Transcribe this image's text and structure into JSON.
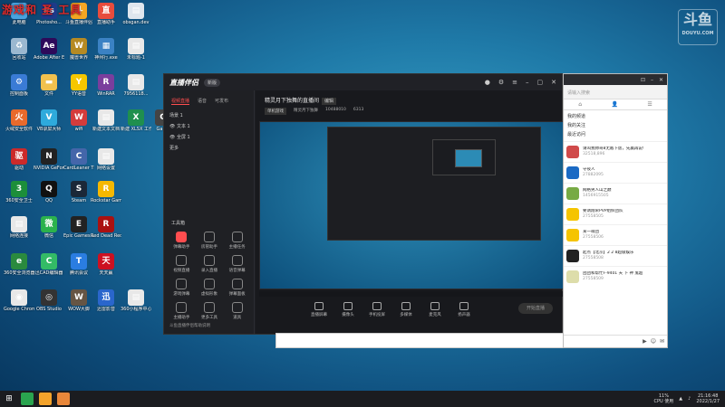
{
  "overlay": {
    "title": "游戏和 圣 工具"
  },
  "watermark": {
    "big": "斗鱼",
    "small": "DOUYU.COM"
  },
  "desktop_icons": [
    {
      "label": "此电脑",
      "color": "#4aa3df",
      "glyph": "▭"
    },
    {
      "label": "Photosho...",
      "color": "#1e3a8a",
      "glyph": "Ps"
    },
    {
      "label": "斗鱼直播伴侣",
      "color": "#f5a623",
      "glyph": "斗"
    },
    {
      "label": "直播助手",
      "color": "#e84c3d",
      "glyph": "直"
    },
    {
      "label": "obsgan.dev",
      "color": "#dfe6ee",
      "glyph": "▤"
    },
    {
      "label": "回收站",
      "color": "#9bb8d0",
      "glyph": "♻"
    },
    {
      "label": "Adobe After Effects 2020",
      "color": "#2d0a5a",
      "glyph": "Ae"
    },
    {
      "label": "魔兽世界",
      "color": "#b58a23",
      "glyph": "W"
    },
    {
      "label": "神州行.exe",
      "color": "#3b82c4",
      "glyph": "▦"
    },
    {
      "label": "未标题-1",
      "color": "#e8e8e8",
      "glyph": "▤"
    },
    {
      "label": "控制面板",
      "color": "#3a7bd5",
      "glyph": "⚙"
    },
    {
      "label": "文件",
      "color": "#f2c14e",
      "glyph": "▬"
    },
    {
      "label": "YY语音",
      "color": "#f6c700",
      "glyph": "Y"
    },
    {
      "label": "WinRAR",
      "color": "#7a3e9d",
      "glyph": "R"
    },
    {
      "label": "7956118...",
      "color": "#e8e8e8",
      "glyph": "▤"
    },
    {
      "label": "火绒安全软件",
      "color": "#e86a2c",
      "glyph": "火"
    },
    {
      "label": "VB录屏大师",
      "color": "#2eaadc",
      "glyph": "V"
    },
    {
      "label": "wifi",
      "color": "#d43c3c",
      "glyph": "W"
    },
    {
      "label": "新建文本文档",
      "color": "#e8e8e8",
      "glyph": "▤"
    },
    {
      "label": "新建 XLSX 工作表",
      "color": "#1f8f4e",
      "glyph": "X"
    },
    {
      "label": "Game",
      "color": "#444",
      "glyph": "G"
    },
    {
      "label": "驱动",
      "color": "#cc2a2a",
      "glyph": "驱"
    },
    {
      "label": "NVIDIA GeForce Experience",
      "color": "#222",
      "glyph": "N"
    },
    {
      "label": "CardLeaner The Coin...",
      "color": "#4466aa",
      "glyph": "C"
    },
    {
      "label": "网络设置",
      "color": "#e8e8e8",
      "glyph": "▤"
    },
    {
      "label": "360安全卫士",
      "color": "#1c8e3a",
      "glyph": "3"
    },
    {
      "label": "QQ",
      "color": "#111",
      "glyph": "Q"
    },
    {
      "label": "Steam",
      "color": "#1b2838",
      "glyph": "S"
    },
    {
      "label": "Rockstar Games Launcher",
      "color": "#f5b800",
      "glyph": "R"
    },
    {
      "label": "网络连接",
      "color": "#e8e8e8",
      "glyph": "▤"
    },
    {
      "label": "微信",
      "color": "#2bb24c",
      "glyph": "微"
    },
    {
      "label": "Epic Games Launcher",
      "color": "#222",
      "glyph": "E"
    },
    {
      "label": "Red Dead Redemption 2",
      "color": "#a11",
      "glyph": "R"
    },
    {
      "label": "360安全浏览器",
      "color": "#2a8a3e",
      "glyph": "e"
    },
    {
      "label": "迅CAD编辑器",
      "color": "#3b6",
      "glyph": "C"
    },
    {
      "label": "腾讯会议",
      "color": "#2a7de1",
      "glyph": "T"
    },
    {
      "label": "天天赢",
      "color": "#c12",
      "glyph": "天"
    },
    {
      "label": "Google Chrome",
      "color": "#e8e8e8",
      "glyph": "◉"
    },
    {
      "label": "OBS Studio",
      "color": "#333",
      "glyph": "◎"
    },
    {
      "label": "WOW大脚",
      "color": "#654",
      "glyph": "W"
    },
    {
      "label": "迅雷影音",
      "color": "#2a66cc",
      "glyph": "迅"
    },
    {
      "label": "360小程序中心",
      "color": "#e8e8e8",
      "glyph": "▤"
    }
  ],
  "app": {
    "logo": "直播伴侣",
    "version": "新版",
    "side_tabs": [
      "视频直播",
      "语音",
      "可发布"
    ],
    "scenes": [
      "场景 1",
      "文本 1",
      "全屏 1",
      "更多"
    ],
    "tools_title": "工具箱",
    "tools": [
      "弹幕助手",
      "房管助手",
      "主播任务",
      "视频直播",
      "录入直播",
      "语音弹幕",
      "游戏弹幕",
      "虚拟形象",
      "弹幕面板",
      "主播助手",
      "更多工具",
      "道具"
    ],
    "side_footer": "斗鱼直播伴侣帮助说明",
    "stream_title": "精灵月下独舞的直播间",
    "edit": "编辑",
    "category": "单机游戏",
    "meta_text": "精灵月下独舞",
    "room_id": "10488010",
    "hot": "6313",
    "bottom_tools": [
      "直播屏幕",
      "摄像头",
      "手机投屏",
      "多媒体",
      "麦克风",
      "扬声器"
    ],
    "start_label": "开始直播"
  },
  "chat": {
    "search_placeholder": "请输入搜索",
    "tabs": [
      "⌂",
      "👤",
      "☰"
    ],
    "menu": [
      "我的频道",
      "我的关注",
      "最近访问"
    ],
    "items": [
      {
        "name": "请叫我帅哥8无敌下饭，先赢再说!",
        "sub": "32518,896",
        "color": "#d04a4a"
      },
      {
        "name": "守夜人",
        "sub": "27882095",
        "color": "#1a6ac4"
      },
      {
        "name": "网格男人山之巅",
        "sub": "1456915505",
        "color": "#7a4"
      },
      {
        "name": "要请翔荣PVP组织团队",
        "sub": "27558505",
        "color": "#f5c400"
      },
      {
        "name": "某一萌团",
        "sub": "27558506",
        "color": "#f5c400"
      },
      {
        "name": "起点【北京】2 2 8超级娱乐",
        "sub": "27558508",
        "color": "#222"
      },
      {
        "name": "团团和帮忙F-9401 天 下 神 鬼超",
        "sub": "27558509",
        "color": "#dda"
      }
    ]
  },
  "taskbar": {
    "cpu": "11%",
    "cpu_label": "CPU 使用",
    "time": "21:16:48",
    "date": "2022/1/27",
    "apps": [
      "#2aa44f",
      "#f3a32b",
      "#e8873a"
    ]
  }
}
